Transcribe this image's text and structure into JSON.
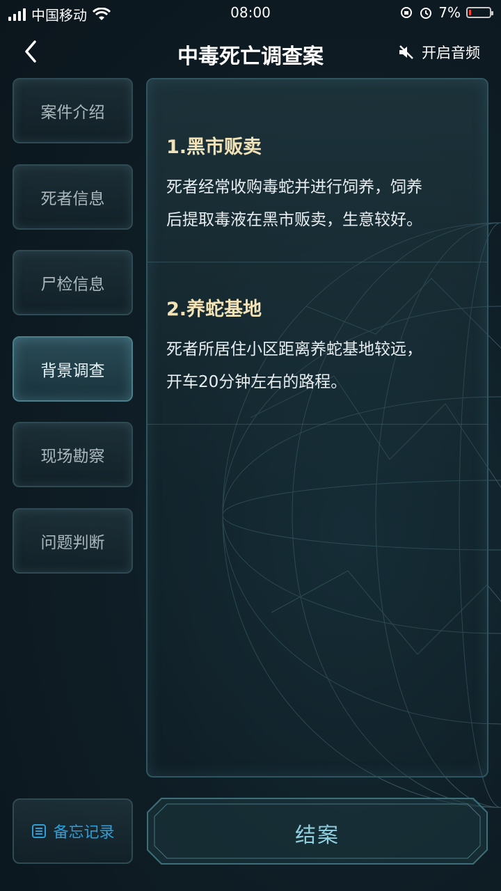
{
  "status_bar": {
    "carrier": "中国移动",
    "time": "08:00",
    "battery_percent": "7%",
    "battery_level": 0.07
  },
  "header": {
    "title": "中毒死亡调查案",
    "audio_label": "开启音频",
    "back_icon": "chevron-left-icon",
    "audio_icon": "speaker-muted-icon"
  },
  "sidebar": {
    "items": [
      {
        "label": "案件介绍",
        "active": false
      },
      {
        "label": "死者信息",
        "active": false
      },
      {
        "label": "尸检信息",
        "active": false
      },
      {
        "label": "背景调查",
        "active": true
      },
      {
        "label": "现场勘察",
        "active": false
      },
      {
        "label": "问题判断",
        "active": false
      }
    ]
  },
  "content": {
    "sections": [
      {
        "title": "1.黑市贩卖",
        "lines": [
          "死者经常收购毒蛇并进行饲养，饲养",
          "后提取毒液在黑市贩卖，生意较好。"
        ]
      },
      {
        "title": "2.养蛇基地",
        "lines": [
          "死者所居住小区距离养蛇基地较远，",
          "开车20分钟左右的路程。"
        ]
      }
    ]
  },
  "bottom": {
    "memo_label": "备忘记录",
    "memo_icon": "list-icon",
    "close_case_label": "结案"
  },
  "colors": {
    "background": "#0f1e26",
    "section_title": "#f1e2b8",
    "memo_accent": "#2f9ed7",
    "battery_low": "#ff3b30"
  }
}
